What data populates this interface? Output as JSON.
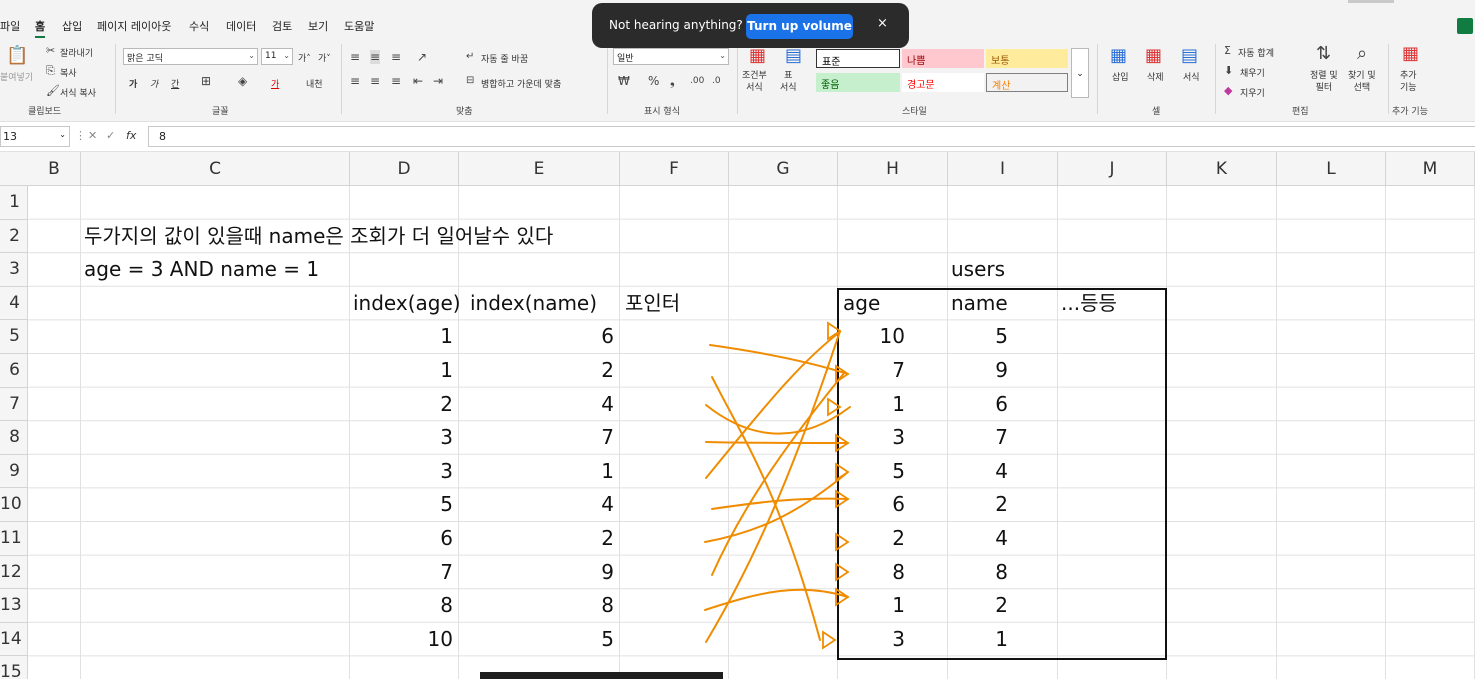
{
  "menu": {
    "tabs": [
      "파일",
      "홈",
      "삽입",
      "페이지 레이아웃",
      "수식",
      "데이터",
      "검토",
      "보기",
      "도움말"
    ],
    "active_tab": "홈"
  },
  "toast": {
    "message": "Not hearing anything?",
    "button": "Turn up volume",
    "close": "×"
  },
  "ribbon": {
    "clipboard": {
      "paste": "붙여넣기",
      "cut": "잘라내기",
      "copy": "복사",
      "format_painter": "서식 복사",
      "label": "클립보드"
    },
    "font": {
      "font_name": "맑은 고딕",
      "font_size": "11",
      "grow": "가˄",
      "shrink": "가˅",
      "bold": "가",
      "italic": "가",
      "underline": "간",
      "font_color_glyph": "가",
      "phonetic": "내천",
      "label": "글꼴"
    },
    "alignment": {
      "wrap_text": "자동 줄 바꿈",
      "merge_center": "병합하고 가운데 맞춤",
      "label": "맞춤"
    },
    "number": {
      "format": "일반",
      "label": "표시 형식"
    },
    "styles": {
      "conditional": "조건부\n서식",
      "table": "표\n서식",
      "cells": [
        {
          "text": "표준",
          "bg": "#ffffff",
          "fg": "#000000"
        },
        {
          "text": "나쁨",
          "bg": "#ffc7ce",
          "fg": "#9c0006"
        },
        {
          "text": "보통",
          "bg": "#ffeb9c",
          "fg": "#9c5700"
        },
        {
          "text": "좋음",
          "bg": "#c6efce",
          "fg": "#006100"
        },
        {
          "text": "경고문",
          "bg": "#ffffff",
          "fg": "#ff0000"
        },
        {
          "text": "계산",
          "bg": "#f2f2f2",
          "fg": "#fa7d00"
        }
      ],
      "label": "스타일"
    },
    "cells": {
      "insert": "삽입",
      "delete": "삭제",
      "format": "서식",
      "label": "셀"
    },
    "editing": {
      "autosum": "자동 합계",
      "fill": "채우기",
      "clear": "지우기",
      "sort_filter": "정렬 및\n필터",
      "find_select": "찾기 및\n선택",
      "label": "편집"
    },
    "addins": {
      "addins": "추가\n기능",
      "label": "추가 기능"
    }
  },
  "formula_bar": {
    "name_box": "13",
    "fx": "fx",
    "value": "8"
  },
  "sheet": {
    "columns": [
      "B",
      "C",
      "D",
      "E",
      "F",
      "G",
      "H",
      "I",
      "J",
      "K",
      "L",
      "M"
    ],
    "rows": [
      "1",
      "2",
      "3",
      "4",
      "5",
      "6",
      "7",
      "8",
      "9",
      "10",
      "11",
      "12",
      "13",
      "14",
      "15"
    ],
    "title_text": "두가지의 값이 있을때 name은 조회가 더 일어날수 있다",
    "condition_text": "age = 3 AND name = 1",
    "index_headers": [
      "index(age)",
      "index(name)",
      "포인터"
    ],
    "index_values": [
      [
        1,
        6
      ],
      [
        1,
        2
      ],
      [
        2,
        4
      ],
      [
        3,
        7
      ],
      [
        3,
        1
      ],
      [
        5,
        4
      ],
      [
        6,
        2
      ],
      [
        7,
        9
      ],
      [
        8,
        8
      ],
      [
        10,
        5
      ]
    ],
    "users_title": "users",
    "users_headers": [
      "age",
      "name",
      "...등등"
    ],
    "users_values": [
      [
        10,
        5
      ],
      [
        7,
        9
      ],
      [
        1,
        6
      ],
      [
        3,
        7
      ],
      [
        5,
        4
      ],
      [
        6,
        2
      ],
      [
        2,
        4
      ],
      [
        8,
        8
      ],
      [
        1,
        2
      ],
      [
        3,
        1
      ]
    ],
    "arrow_color": "#f08c00"
  }
}
